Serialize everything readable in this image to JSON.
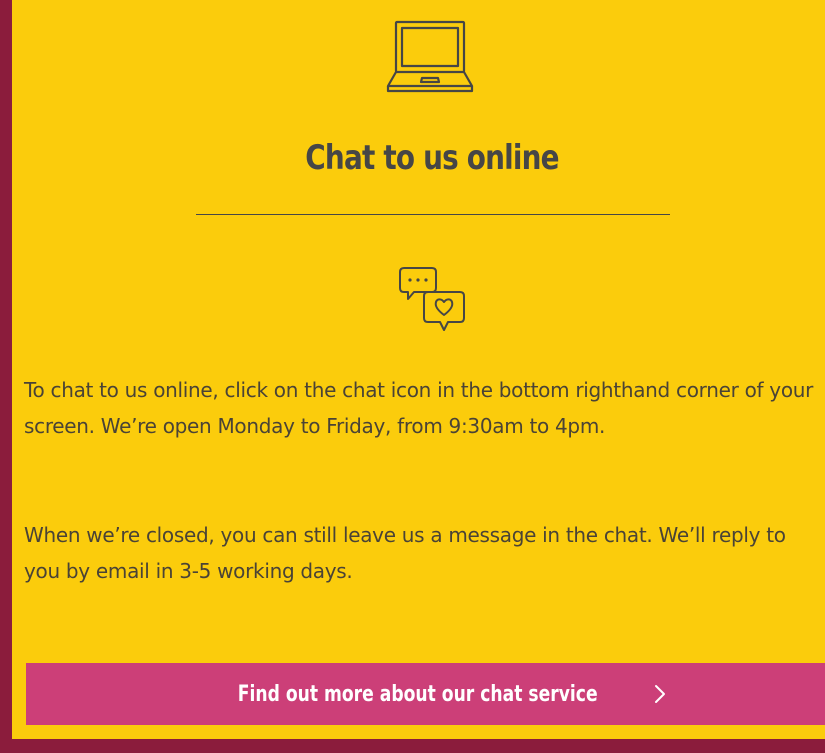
{
  "card": {
    "title": "Chat to us online",
    "paragraph_1": "To chat to us online, click on the chat icon in the bottom righthand corner of your screen. We’re open Monday to Friday, from 9:30am to 4pm.",
    "paragraph_2": "When we’re closed, you can still leave us a message in the chat. We’ll reply to you by email in 3-5 working days.",
    "cta_label": "Find out more about our chat service"
  },
  "icons": {
    "top": "laptop-icon",
    "middle": "chat-bubbles-heart-icon",
    "button": "chevron-right-icon"
  },
  "colors": {
    "page_background": "#8b1c3c",
    "card_background": "#fbcc0c",
    "text": "#4a4336",
    "heading": "#464646",
    "button_background": "#cc3f78",
    "button_text": "#ffffff"
  }
}
